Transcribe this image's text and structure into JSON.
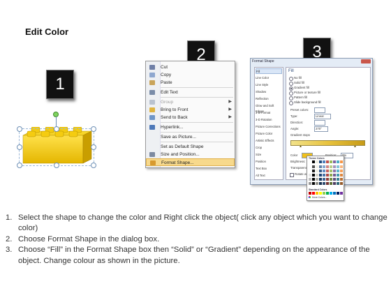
{
  "title": "Edit Color",
  "badges": [
    "1",
    "2",
    "3"
  ],
  "colors": {
    "lego_yellow": "#f2c500",
    "lego_shadow": "#c49900",
    "menu_highlight": "#f7d98c"
  },
  "context_menu": {
    "items": [
      {
        "label": "Cut",
        "icon": "scissors-icon"
      },
      {
        "label": "Copy",
        "icon": "copy-icon"
      },
      {
        "label": "Paste",
        "icon": "paste-icon"
      },
      {
        "label": "Edit Text",
        "icon": "edit-text-icon"
      },
      {
        "label": "Group",
        "icon": "group-icon",
        "submenu": true,
        "disabled": true
      },
      {
        "label": "Bring to Front",
        "icon": "bring-front-icon",
        "submenu": true
      },
      {
        "label": "Send to Back",
        "icon": "send-back-icon",
        "submenu": true
      },
      {
        "label": "Hyperlink...",
        "icon": "hyperlink-icon"
      },
      {
        "label": "Save as Picture...",
        "icon": ""
      },
      {
        "label": "Set as Default Shape",
        "icon": ""
      },
      {
        "label": "Size and Position...",
        "icon": "size-position-icon"
      },
      {
        "label": "Format Shape...",
        "icon": "format-shape-icon",
        "selected": true
      }
    ]
  },
  "format_dialog": {
    "title": "Format Shape",
    "categories": [
      "Fill",
      "Line Color",
      "Line Style",
      "Shadow",
      "Reflection",
      "Glow and Soft Edges",
      "3-D Format",
      "3-D Rotation",
      "Picture Corrections",
      "Picture Color",
      "Artistic Effects",
      "Crop",
      "Size",
      "Position",
      "Text Box",
      "Alt Text"
    ],
    "section_title": "Fill",
    "fill_options": [
      "No fill",
      "Solid fill",
      "Gradient fill",
      "Picture or texture fill",
      "Pattern fill",
      "Slide background fill"
    ],
    "selected_fill": "Gradient fill",
    "preset_colors_label": "Preset colors:",
    "type_label": "Type:",
    "type_value": "Linear",
    "direction_label": "Direction:",
    "angle_label": "Angle:",
    "angle_value": "270°",
    "gradient_stops_label": "Gradient stops",
    "color_label": "Color",
    "position_label": "Position:",
    "position_value": "0%",
    "brightness_label": "Brightness:",
    "transparency_label": "Transparency:",
    "rotate_label": "Rotate w",
    "theme_colors_label": "Theme Colors",
    "standard_colors_label": "Standard Colors",
    "more_colors_label": "More Colors..."
  },
  "instructions": [
    {
      "num": "1.",
      "text": "Select the shape to change the color and Right click the object( click any object which you want to change color)"
    },
    {
      "num": "2.",
      "text": "Choose Format Shape in the dialog box."
    },
    {
      "num": "3.",
      "text": "Choose “Fill” in the Format Shape box then “Solid” or “Gradient” depending on the appearance of the object. Change colour as shown in the picture."
    }
  ]
}
